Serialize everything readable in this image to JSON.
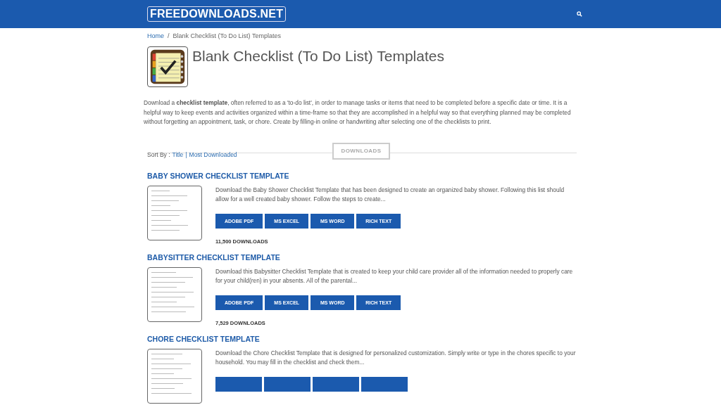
{
  "header": {
    "logo": "FREEDOWNLOADS.NET"
  },
  "breadcrumb": [
    {
      "label": "Home",
      "kind": "link"
    },
    {
      "label": "/",
      "kind": "separator"
    },
    {
      "label": "Blank Checklist (To Do List) Templates",
      "kind": "current"
    }
  ],
  "page": {
    "title": "Blank Checklist (To Do List) Templates",
    "intro": "Download a **checklist template**, often referred to as a 'to-do list', in order to manage tasks or items that need to be completed before a specific date or time. It is a helpful way to keep events and activities organized within a time-frame so that they are accomplished in a helpful way so that everything planned may be completed without forgetting an appointment, task, or chore. Create by filling-in online or handwriting after selecting one of the checklists to print."
  },
  "sort": {
    "label": "Sort By :",
    "options": [
      "Title",
      "|",
      "Most Downloaded"
    ],
    "section_label": "DOWNLOADS"
  },
  "items": [
    {
      "title": "BABY SHOWER CHECKLIST TEMPLATE",
      "description": "Download the Baby Shower Checklist Template that has been designed to create an organized baby shower. Following this list should allow for a well created baby shower. Follow the steps to create...",
      "buttons": [
        {
          "kind": "full",
          "label": "ADOBE PDF"
        },
        {
          "kind": "full",
          "label": "MS EXCEL"
        },
        {
          "kind": "full",
          "label": "MS WORD"
        },
        {
          "kind": "full",
          "label": "RICH TEXT"
        }
      ],
      "downloads": "11,500 DOWNLOADS"
    },
    {
      "title": "BABYSITTER CHECKLIST TEMPLATE",
      "description": "Download this Babysitter Checklist Template that is created to keep your child care provider all of the information needed to properly care for your child(ren) in your absents.  All of the parental...",
      "buttons": [
        {
          "kind": "full",
          "label": "ADOBE PDF"
        },
        {
          "kind": "full",
          "label": "MS EXCEL"
        },
        {
          "kind": "full",
          "label": "MS WORD"
        },
        {
          "kind": "full",
          "label": "RICH TEXT"
        }
      ],
      "downloads": "7,529 DOWNLOADS"
    },
    {
      "title": "CHORE CHECKLIST TEMPLATE",
      "description": "Download the Chore Checklist Template that is designed for personalized customization. Simply write or type in the chores specific to your household. You may fill in the checklist and check them...",
      "buttons": [
        {
          "kind": "cut"
        },
        {
          "kind": "cut"
        },
        {
          "kind": "cut"
        },
        {
          "kind": "cut"
        }
      ]
    }
  ]
}
